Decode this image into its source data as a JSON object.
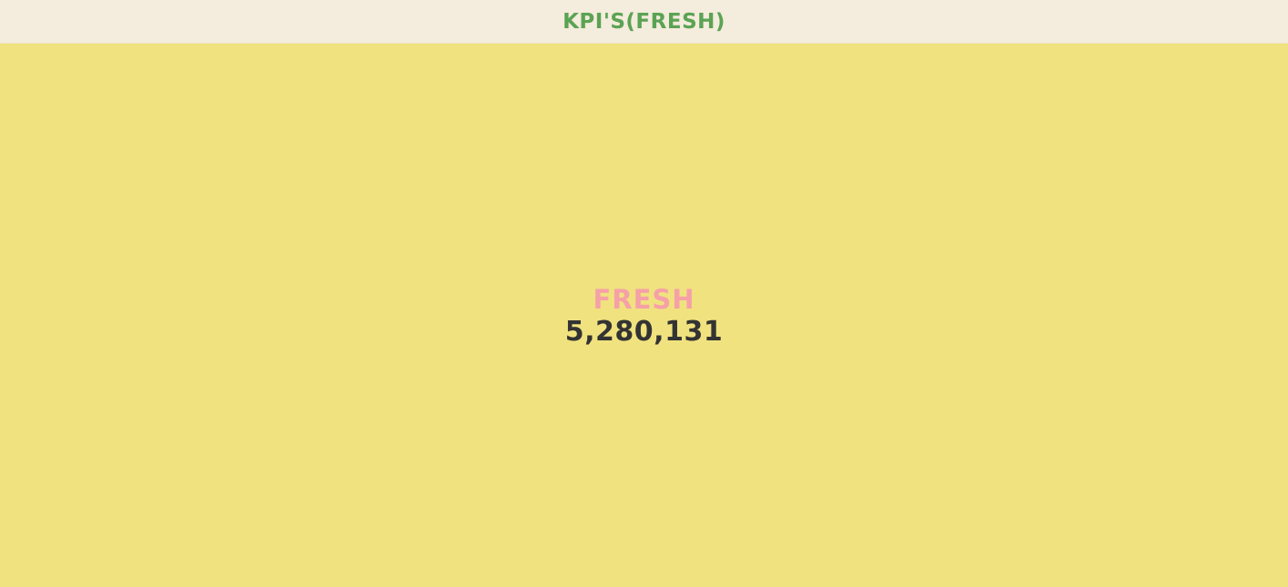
{
  "header": {
    "title": "KPI'S(FRESH)"
  },
  "kpi": {
    "label": "FRESH",
    "value": "5,280,131"
  },
  "colors": {
    "header_background": "#f4ecdc",
    "title_text": "#5ba354",
    "panel_background": "#f0e27f",
    "kpi_label_text": "#f6a0a8",
    "kpi_value_text": "#333333"
  }
}
